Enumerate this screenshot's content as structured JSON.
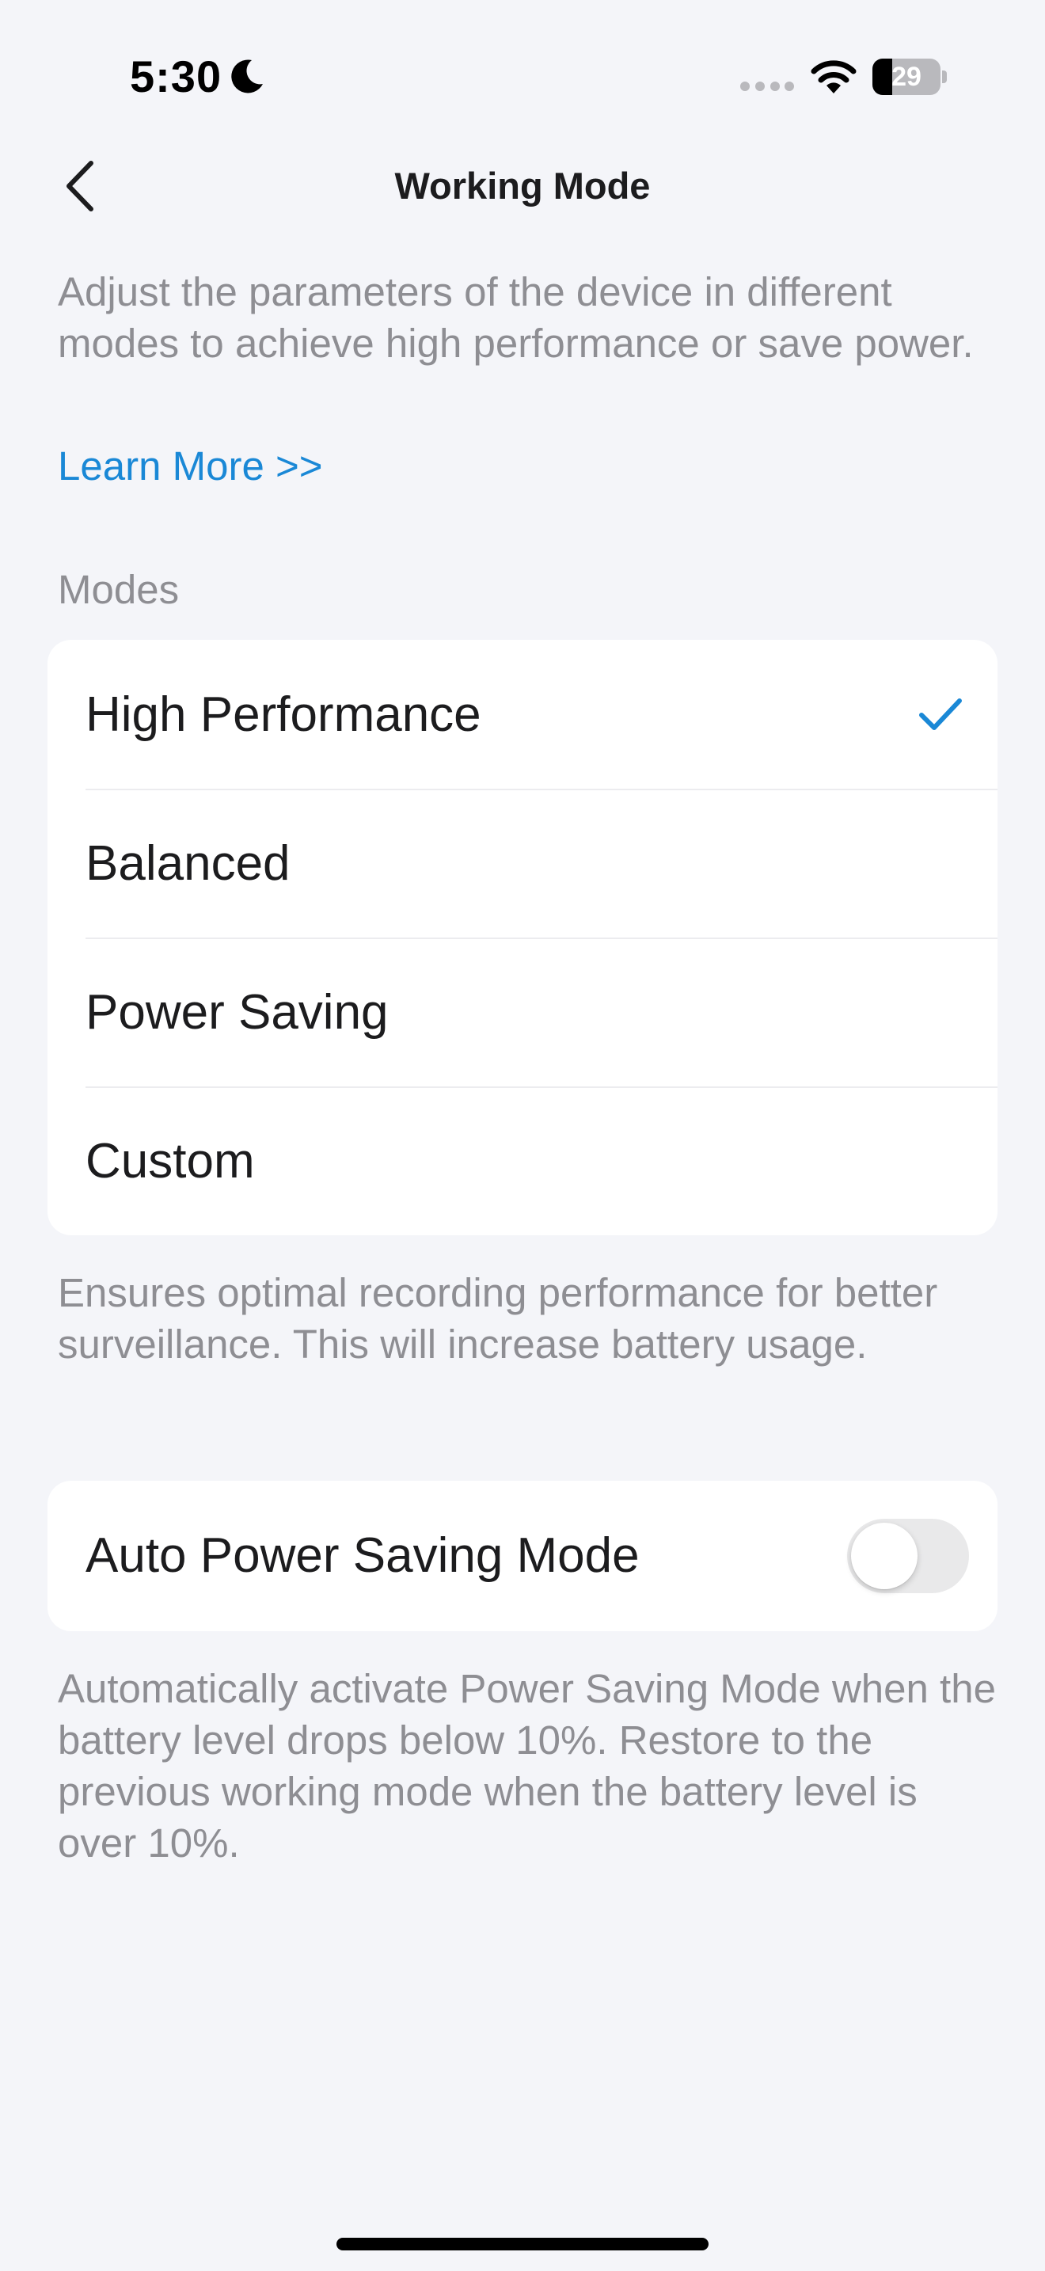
{
  "status_bar": {
    "time": "5:30",
    "battery_level": "29",
    "battery_fraction": 0.29,
    "icons": [
      "moon-icon",
      "signal-icon",
      "wifi-icon",
      "battery-icon"
    ]
  },
  "nav": {
    "title": "Working Mode",
    "back_icon": "chevron-left-icon"
  },
  "intro": {
    "description": "Adjust the parameters of the device in different modes to achieve high performance or save power.",
    "learn_more": "Learn More >>"
  },
  "modes": {
    "section_title": "Modes",
    "items": [
      {
        "label": "High Performance",
        "selected": true
      },
      {
        "label": "Balanced",
        "selected": false
      },
      {
        "label": "Power Saving",
        "selected": false
      },
      {
        "label": "Custom",
        "selected": false
      }
    ],
    "selected_icon": "checkmark-icon",
    "note": "Ensures optimal recording performance for better surveillance. This will increase battery usage."
  },
  "auto_power_saving": {
    "label": "Auto Power Saving Mode",
    "enabled": false,
    "note": "Automatically activate Power Saving Mode when the battery level drops below 10%. Restore to the previous working mode when the battery level is over 10%."
  },
  "colors": {
    "accent": "#1a88d6",
    "background": "#f4f5f9",
    "card": "#ffffff",
    "secondary_text": "#8e8e93",
    "toggle_off": "#e9e9ea"
  }
}
